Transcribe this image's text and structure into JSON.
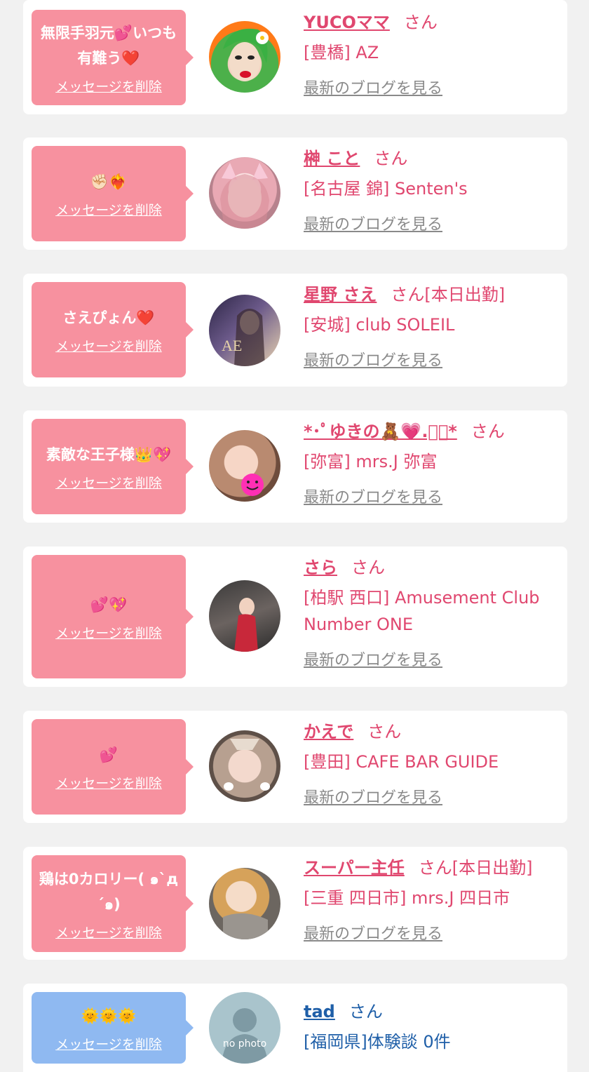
{
  "delete_label": "メッセージを削除",
  "blog_label": "最新のブログを見る",
  "messages": [
    {
      "text": "無限手羽元💕いつも有難う❤️",
      "name": "YUCOママ",
      "honorific": "さん",
      "status": "",
      "shop": "[豊橋] AZ"
    },
    {
      "text": "✊🏻❤️‍🔥",
      "name": "榊 こと",
      "honorific": "さん",
      "status": "",
      "shop": "[名古屋 錦] Senten's"
    },
    {
      "text": "さえぴょん❤️",
      "name": "星野 さえ",
      "honorific": "さん",
      "status": "[本日出勤]",
      "shop": "[安城] club SOLEIL"
    },
    {
      "text": "素敵な王子様👑💖",
      "name": "*･ﾟゆきの🧸💗.ﾟ･*",
      "honorific": "さん",
      "status": "",
      "shop": "[弥富] mrs.J 弥富"
    },
    {
      "text": "💕💖",
      "name": "さら",
      "honorific": "さん",
      "status": "",
      "shop": "[柏駅 西口] Amusement Club Number ONE"
    },
    {
      "text": "💕",
      "name": "かえで",
      "honorific": "さん",
      "status": "",
      "shop": "[豊田] CAFE BAR GUIDE"
    },
    {
      "text": "鶏は0カロリー( ๑`д´๑)",
      "name": "スーパー主任",
      "honorific": "さん",
      "status": "[本日出勤]",
      "shop": "[三重 四日市] mrs.J 四日市"
    },
    {
      "text": "🌞🌞🌞",
      "name": "tad",
      "honorific": "さん",
      "status": "",
      "shop": "[福岡県]体験談 0件"
    }
  ],
  "nophoto": "no photo",
  "colors": {
    "accent_pink": "#e0476f",
    "bubble_pink": "#f7919f",
    "bubble_blue": "#8fb9f1",
    "link_blue": "#1f5fa8"
  }
}
